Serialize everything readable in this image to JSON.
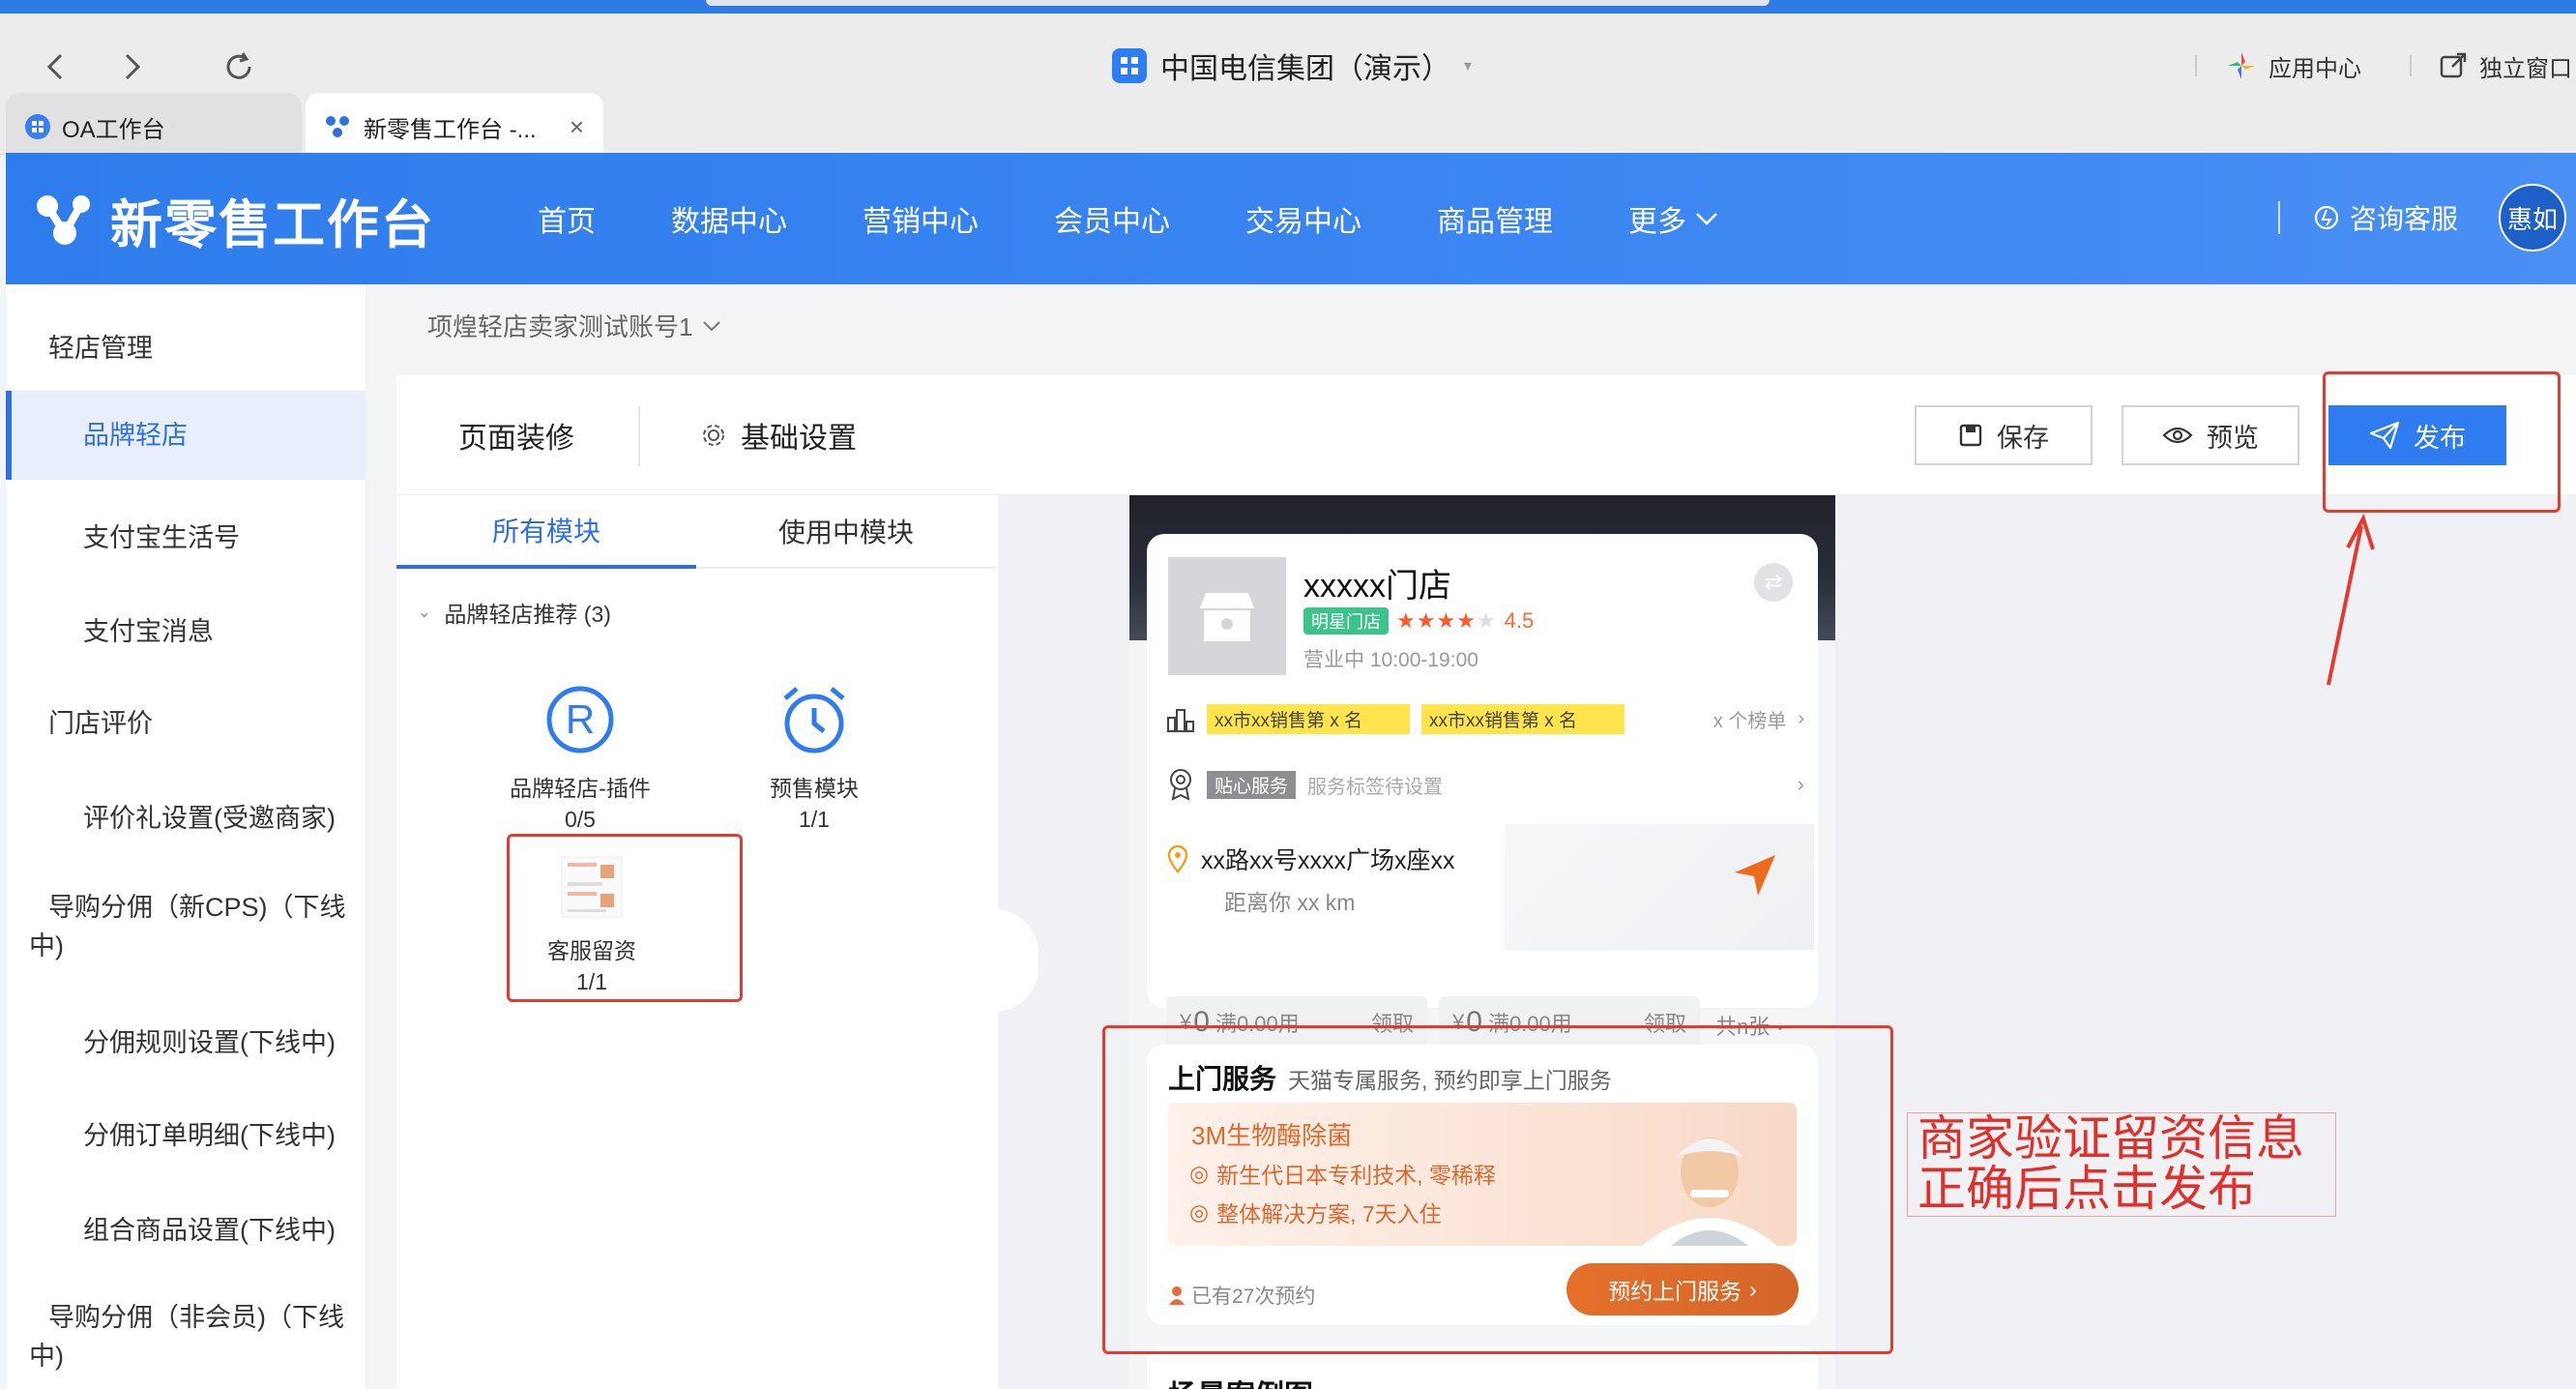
{
  "browser": {
    "window_title": "中国电信集团（演示）",
    "app_center": "应用中心",
    "standalone_window": "独立窗口",
    "tabs": [
      {
        "label": "OA工作台"
      },
      {
        "label": "新零售工作台 -..."
      }
    ]
  },
  "header": {
    "logo_text": "新零售工作台",
    "nav": [
      "首页",
      "数据中心",
      "营销中心",
      "会员中心",
      "交易中心",
      "商品管理",
      "更多"
    ],
    "consult": "咨询客服",
    "avatar": "惠如"
  },
  "sidebar": {
    "items": [
      {
        "label": "轻店管理"
      },
      {
        "label": "品牌轻店"
      },
      {
        "label": "支付宝生活号"
      },
      {
        "label": "支付宝消息"
      },
      {
        "label": "门店评价"
      },
      {
        "label": "评价礼设置(受邀商家)"
      },
      {
        "label": "导购分佣（新CPS)（下线中)"
      },
      {
        "label": "分佣规则设置(下线中)"
      },
      {
        "label": "分佣订单明细(下线中)"
      },
      {
        "label": "组合商品设置(下线中)"
      },
      {
        "label": "导购分佣（非会员)（下线中)"
      }
    ]
  },
  "breadcrumb": "项煌轻店卖家测试账号1",
  "toolbar": {
    "page_decoration": "页面装修",
    "basic_settings": "基础设置",
    "save": "保存",
    "preview": "预览",
    "publish": "发布"
  },
  "modules_panel": {
    "tabs": [
      "所有模块",
      "使用中模块"
    ],
    "group_title": "品牌轻店推荐 (3)",
    "modules": [
      {
        "name": "品牌轻店-插件",
        "count": "0/5"
      },
      {
        "name": "预售模块",
        "count": "1/1"
      },
      {
        "name": "客服留资",
        "count": "1/1"
      }
    ]
  },
  "phone": {
    "store_name": "xxxxx门店",
    "star_badge": "明星门店",
    "rating": "4.5",
    "rating_stars": 4,
    "hours": "营业中 10:00-19:00",
    "rank_tags": [
      "xx市xx销售第 x 名",
      "xx市xx销售第 x 名"
    ],
    "rank_link": "x 个榜单",
    "service_tag": "贴心服务",
    "service_setting": "服务标签待设置",
    "address": "xx路xx号xxxx广场x座xx",
    "distance": "距离你 xx km",
    "coupons": [
      {
        "symbol": "¥",
        "amount": "0",
        "cond": "满0.00用",
        "action": "领取"
      },
      {
        "symbol": "¥",
        "amount": "0",
        "cond": "满0.00用",
        "action": "领取"
      }
    ],
    "coupon_more": "共n张",
    "onsite": {
      "title": "上门服务",
      "subtitle": "天猫专属服务, 预约即享上门服务",
      "product": "3M生物酶除菌",
      "feature1": "新生代日本专利技术, 零稀释",
      "feature2": "整体解决方案, 7天入住",
      "booked": "已有27次预约",
      "cta": "预约上门服务"
    },
    "bottom_title": "场景案例图"
  },
  "annotation": {
    "line1": "商家验证留资信息",
    "line2": "正确后点击发布"
  },
  "colors": {
    "brand_blue": "#2f7cec",
    "annotation_red": "#e23b32",
    "orange_cta": "#e8752a"
  }
}
